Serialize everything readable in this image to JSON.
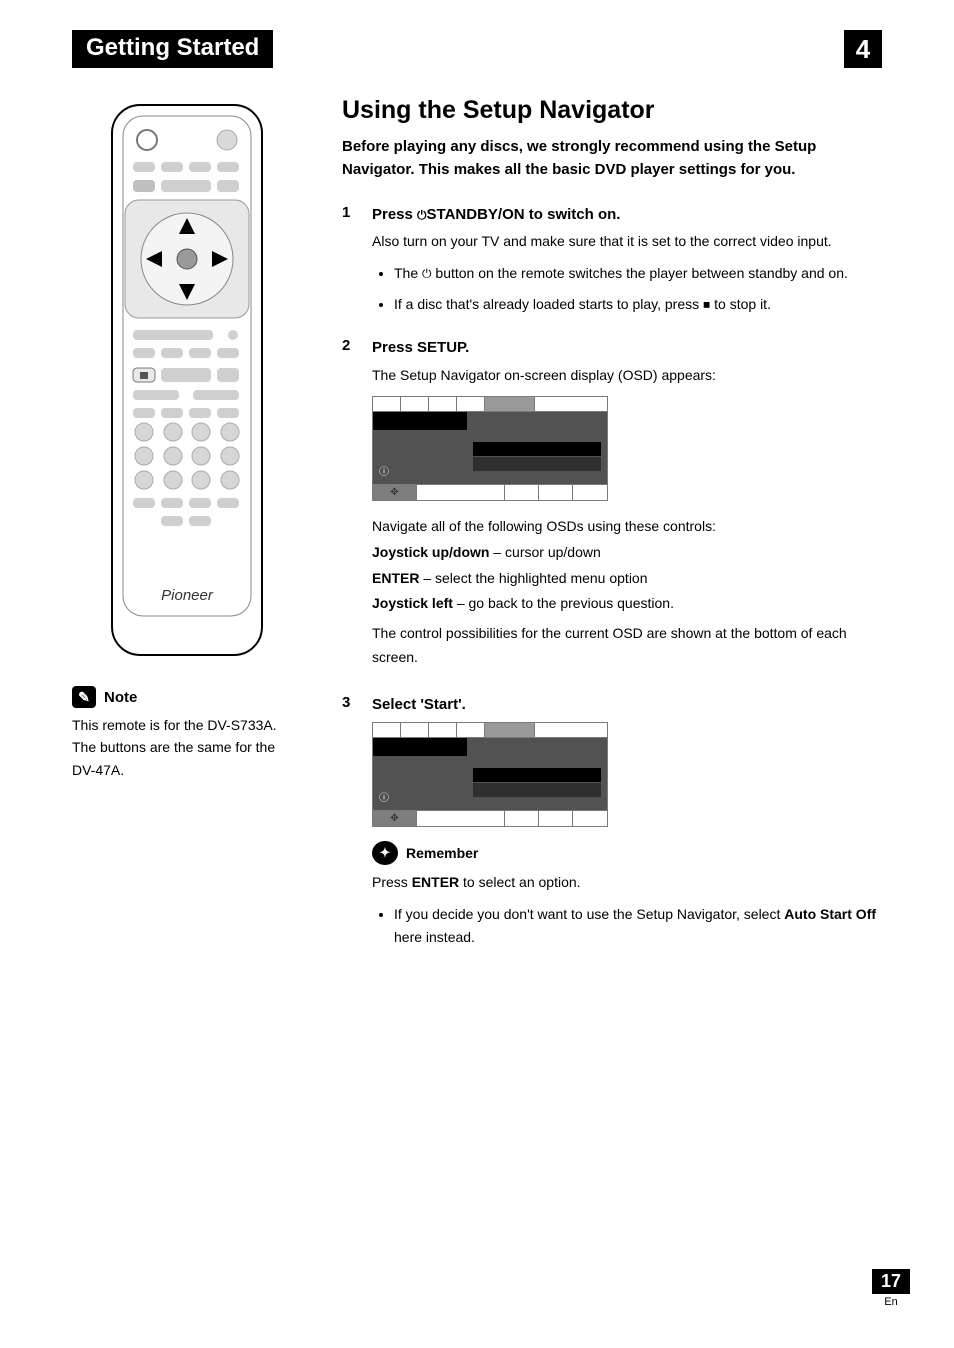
{
  "header": {
    "chapter_title": "Getting Started",
    "chapter_number": "4"
  },
  "left": {
    "brand": "Pioneer",
    "note_label": "Note",
    "note_text": "This remote is for the DV-S733A. The buttons are the same for the DV-47A."
  },
  "section": {
    "title": "Using the Setup Navigator",
    "intro": "Before playing any discs, we strongly recommend using the Setup Navigator. This makes all the basic DVD player settings for you."
  },
  "steps": {
    "s1": {
      "num": "1",
      "head_pre": "Press ",
      "head_icon": "⏻",
      "head_post": "STANDBY/ON to switch on.",
      "sub": "Also turn on your TV and make sure that it is set to the correct video input.",
      "b1_pre": "The ",
      "b1_icon": "⏻",
      "b1_post": " button on the remote switches the player between standby and on.",
      "b2_pre": "If a disc that's already loaded starts to play, press ",
      "b2_icon": "■",
      "b2_post": " to stop it."
    },
    "s2": {
      "num": "2",
      "head": "Press SETUP.",
      "sub": "The Setup Navigator on-screen display (OSD) appears:",
      "nav_line": "Navigate all of the following OSDs using these controls:",
      "c1_b": "Joystick up/down",
      "c1_r": " – cursor up/down",
      "c2_b": "ENTER",
      "c2_r": " – select the highlighted menu option",
      "c3_b": "Joystick left",
      "c3_r": " – go back to the previous question.",
      "tail": "The control possibilities for the current OSD are shown at the bottom of each screen."
    },
    "s3": {
      "num": "3",
      "head": "Select 'Start'.",
      "remember_label": "Remember",
      "remember_pre": "Press ",
      "remember_b": "ENTER",
      "remember_post": " to select an option.",
      "b1_pre": "If you decide you don't want to use the Setup Navigator, select ",
      "b1_b": "Auto Start Off",
      "b1_post": " here instead."
    }
  },
  "footer": {
    "page": "17",
    "lang": "En"
  },
  "icons": {
    "power": "⏻",
    "stop": "■",
    "info": "ⓘ",
    "move": "✥",
    "pencil": "✎",
    "bulb": "✦"
  }
}
